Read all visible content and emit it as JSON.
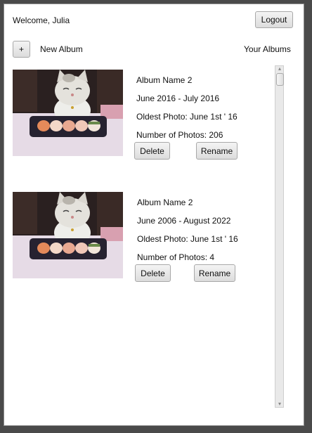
{
  "header": {
    "welcome_text": "Welcome, Julia",
    "logout_label": "Logout"
  },
  "toolbar": {
    "add_label": "+",
    "new_album_label": "New Album",
    "your_albums_label": "Your Albums"
  },
  "albums": [
    {
      "name": "Album Name 2",
      "date_range": "June 2016 - July 2016",
      "oldest": "Oldest Photo: June 1st ' 16",
      "count": "Number of Photos: 206",
      "delete_label": "Delete",
      "rename_label": "Rename",
      "thumbnail_icon": "cat-with-sushi-photo"
    },
    {
      "name": "Album Name 2",
      "date_range": "June 2006 - August 2022",
      "oldest": "Oldest Photo: June 1st ' 16",
      "count": "Number of Photos: 4",
      "delete_label": "Delete",
      "rename_label": "Rename",
      "thumbnail_icon": "cat-with-sushi-photo"
    }
  ],
  "scrollbar": {
    "up_icon": "chevron-up-icon",
    "down_icon": "chevron-down-icon"
  }
}
